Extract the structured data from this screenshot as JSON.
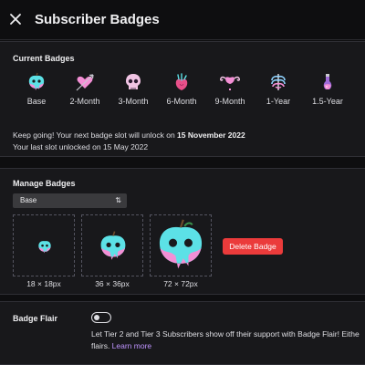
{
  "header": {
    "title": "Subscriber Badges"
  },
  "current": {
    "section_title": "Current Badges",
    "badges": [
      {
        "label": "Base",
        "icon": "skull-apple-icon"
      },
      {
        "label": "2-Month",
        "icon": "arrow-heart-icon"
      },
      {
        "label": "3-Month",
        "icon": "skull-icon"
      },
      {
        "label": "6-Month",
        "icon": "anatomical-heart-icon"
      },
      {
        "label": "9-Month",
        "icon": "uterus-icon"
      },
      {
        "label": "1-Year",
        "icon": "ribcage-icon"
      },
      {
        "label": "1.5-Year",
        "icon": "potion-icon"
      }
    ],
    "next_prefix": "Keep going! Your next badge slot will unlock on ",
    "next_date": "15 November 2022",
    "last_unlocked": "Your last slot unlocked on 15 May 2022"
  },
  "manage": {
    "section_title": "Manage Badges",
    "selected": "Base",
    "sizes": [
      "18 × 18px",
      "36 × 36px",
      "72 × 72px"
    ],
    "delete_label": "Delete Badge"
  },
  "flair": {
    "title": "Badge Flair",
    "enabled": false,
    "line1": "Let Tier 2 and Tier 3 Subscribers show off their support with Badge Flair! Eithe",
    "line2_prefix": "flairs. ",
    "learn_more": "Learn more"
  },
  "colors": {
    "background": "#0e0e10",
    "panel": "#18181b",
    "delete": "#eb3b3b",
    "link": "#bf94ff",
    "badge_cyan": "#5ce1e6",
    "badge_pink": "#f38fd5"
  }
}
